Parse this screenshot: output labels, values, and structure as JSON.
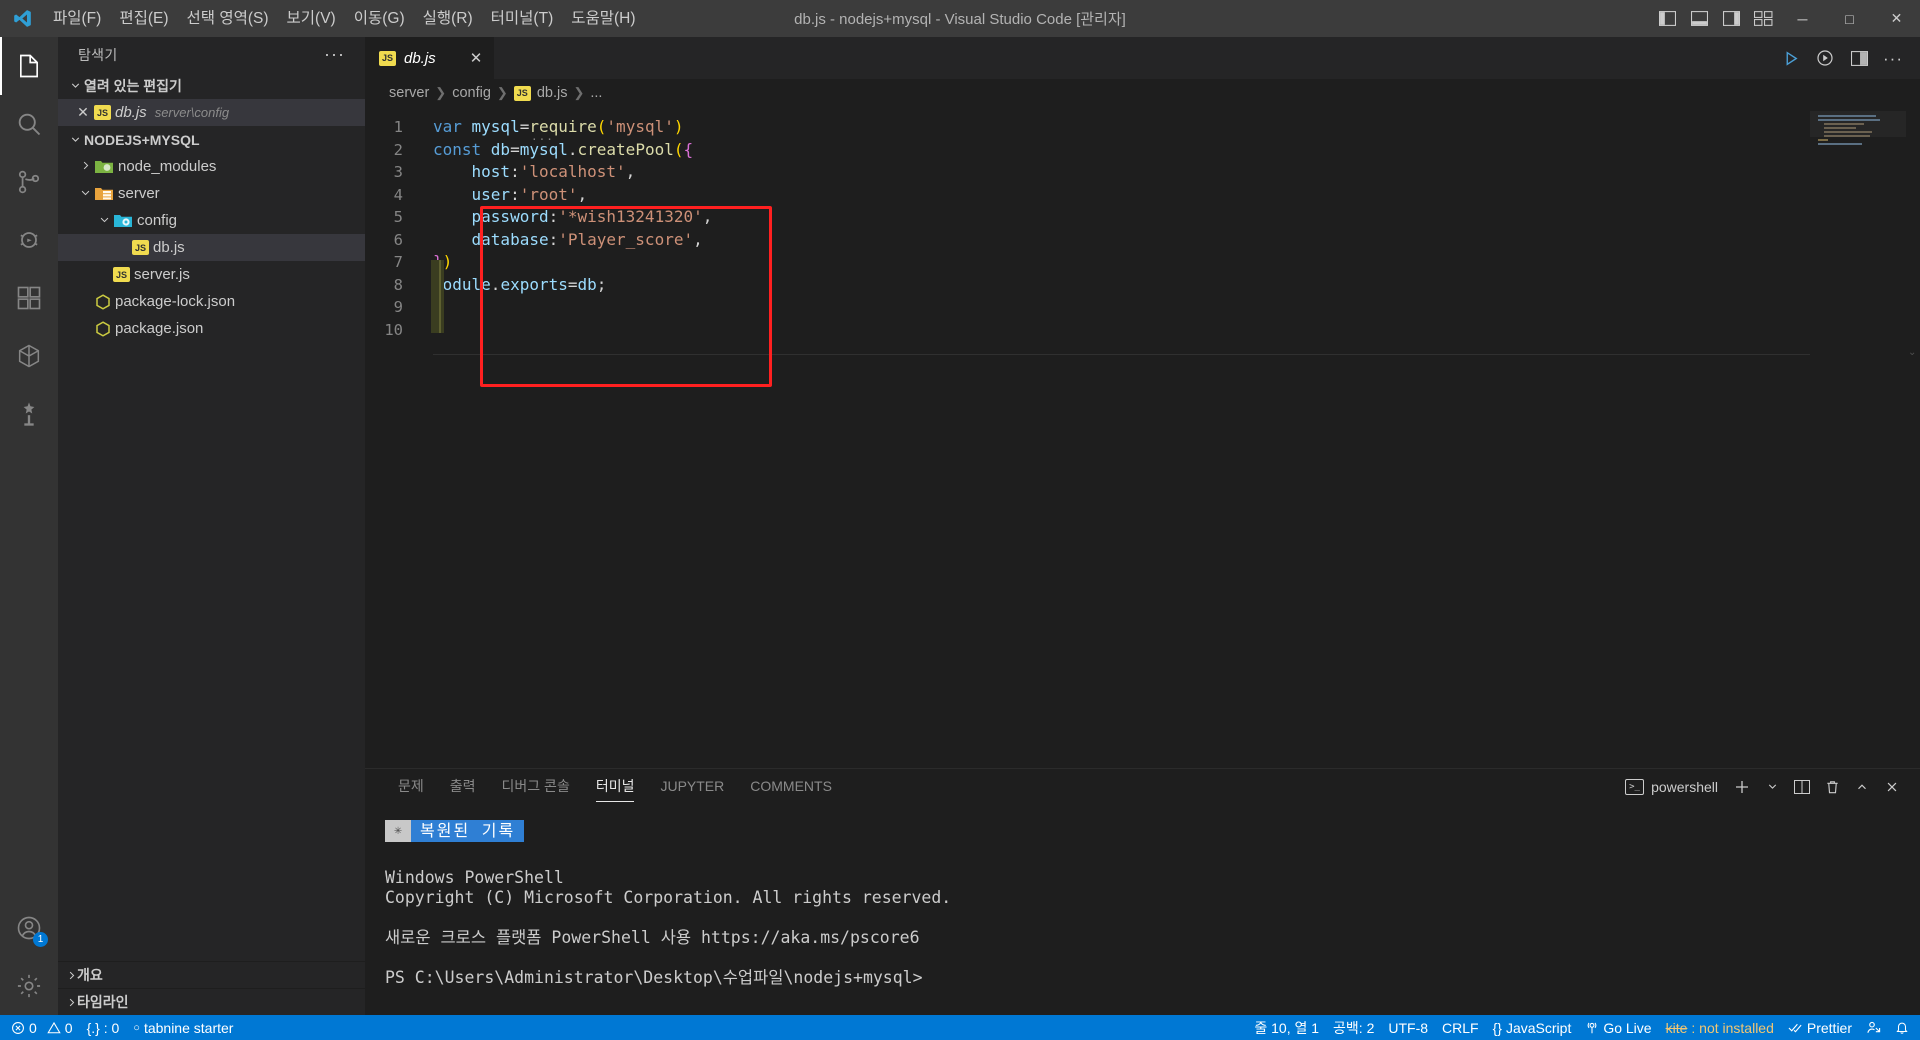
{
  "titlebar": {
    "window_title": "db.js - nodejs+mysql - Visual Studio Code [관리자]",
    "menus": [
      {
        "label": "파일(F)",
        "name": "menu-file"
      },
      {
        "label": "편집(E)",
        "name": "menu-edit"
      },
      {
        "label": "선택 영역(S)",
        "name": "menu-selection"
      },
      {
        "label": "보기(V)",
        "name": "menu-view"
      },
      {
        "label": "이동(G)",
        "name": "menu-go"
      },
      {
        "label": "실행(R)",
        "name": "menu-run"
      },
      {
        "label": "터미널(T)",
        "name": "menu-terminal"
      },
      {
        "label": "도움말(H)",
        "name": "menu-help"
      }
    ],
    "window_controls": {
      "minimize": "─",
      "maximize": "□",
      "close": "✕"
    }
  },
  "activitybar": {
    "items": [
      {
        "name": "explorer",
        "icon": "files-icon",
        "active": true
      },
      {
        "name": "search",
        "icon": "search-icon",
        "active": false
      },
      {
        "name": "source-control",
        "icon": "source-control-icon",
        "active": false
      },
      {
        "name": "run-and-debug",
        "icon": "debug-icon",
        "active": false
      },
      {
        "name": "extensions",
        "icon": "extensions-icon",
        "active": false
      },
      {
        "name": "remote-explorer",
        "icon": "remote-icon",
        "active": false
      },
      {
        "name": "testing",
        "icon": "beaker-icon",
        "active": false
      }
    ],
    "account_badge": "1"
  },
  "sidebar": {
    "title": "탐색기",
    "more_actions": "···",
    "open_editors": {
      "label": "열려 있는 편집기",
      "items": [
        {
          "filename": "db.js",
          "description": "server\\config",
          "icon": "js-file-icon",
          "close": "✕"
        }
      ]
    },
    "workspace": {
      "label": "NODEJS+MYSQL",
      "tree": [
        {
          "label": "node_modules",
          "type": "folder",
          "depth": 1,
          "expanded": false,
          "icon": "folder-node-icon"
        },
        {
          "label": "server",
          "type": "folder",
          "depth": 1,
          "expanded": true,
          "icon": "folder-server-icon"
        },
        {
          "label": "config",
          "type": "folder",
          "depth": 2,
          "expanded": true,
          "icon": "folder-config-icon"
        },
        {
          "label": "db.js",
          "type": "file",
          "depth": 3,
          "icon": "js-file-icon",
          "selected": true
        },
        {
          "label": "server.js",
          "type": "file",
          "depth": 2,
          "icon": "js-file-icon"
        },
        {
          "label": "package-lock.json",
          "type": "file",
          "depth": 1,
          "icon": "json-file-icon"
        },
        {
          "label": "package.json",
          "type": "file",
          "depth": 1,
          "icon": "json-file-icon"
        }
      ]
    },
    "bottom_sections": [
      {
        "label": "개요",
        "name": "outline-section"
      },
      {
        "label": "타임라인",
        "name": "timeline-section"
      }
    ]
  },
  "editor": {
    "tab": {
      "filename": "db.js",
      "icon": "js-file-icon",
      "close": "✕",
      "dirty": false
    },
    "actions": [
      {
        "name": "run-code-button",
        "icon": "play-icon"
      },
      {
        "name": "run-and-debug-button",
        "icon": "play-circle-icon"
      },
      {
        "name": "split-editor-button",
        "icon": "split-icon"
      },
      {
        "name": "more-actions-button",
        "icon": "ellipsis-icon"
      }
    ],
    "breadcrumb": [
      "server",
      "config",
      "db.js",
      "..."
    ],
    "ghost_suggestion": "···",
    "lines": [
      {
        "n": 1,
        "tokens": [
          {
            "t": "var ",
            "c": "t-kw"
          },
          {
            "t": "mysql",
            "c": "t-var"
          },
          {
            "t": "=",
            "c": "t-pn"
          },
          {
            "t": "require",
            "c": "t-fn"
          },
          {
            "t": "(",
            "c": "t-brkt1"
          },
          {
            "t": "'mysql'",
            "c": "t-str"
          },
          {
            "t": ")",
            "c": "t-brkt1"
          }
        ]
      },
      {
        "n": 2,
        "tokens": [
          {
            "t": "const ",
            "c": "t-kw"
          },
          {
            "t": "db",
            "c": "t-var"
          },
          {
            "t": "=",
            "c": "t-pn"
          },
          {
            "t": "mysql",
            "c": "t-var"
          },
          {
            "t": ".",
            "c": "t-pn"
          },
          {
            "t": "createPool",
            "c": "t-fn"
          },
          {
            "t": "(",
            "c": "t-brkt1"
          },
          {
            "t": "{",
            "c": "t-brkt2"
          }
        ]
      },
      {
        "n": 3,
        "tokens": [
          {
            "t": "    host",
            "c": "t-prop"
          },
          {
            "t": ":",
            "c": "t-pn"
          },
          {
            "t": "'localhost'",
            "c": "t-str"
          },
          {
            "t": ",",
            "c": "t-pn"
          }
        ]
      },
      {
        "n": 4,
        "tokens": [
          {
            "t": "    user",
            "c": "t-prop"
          },
          {
            "t": ":",
            "c": "t-pn"
          },
          {
            "t": "'root'",
            "c": "t-str"
          },
          {
            "t": ",",
            "c": "t-pn"
          }
        ]
      },
      {
        "n": 5,
        "tokens": [
          {
            "t": "    password",
            "c": "t-prop"
          },
          {
            "t": ":",
            "c": "t-pn"
          },
          {
            "t": "'*wish13241320'",
            "c": "t-str"
          },
          {
            "t": ",",
            "c": "t-pn"
          }
        ]
      },
      {
        "n": 6,
        "tokens": [
          {
            "t": "    database",
            "c": "t-prop"
          },
          {
            "t": ":",
            "c": "t-pn"
          },
          {
            "t": "'Player_score'",
            "c": "t-str"
          },
          {
            "t": ",",
            "c": "t-pn"
          }
        ]
      },
      {
        "n": 7,
        "tokens": [
          {
            "t": "}",
            "c": "t-brkt2"
          },
          {
            "t": ")",
            "c": "t-brkt1"
          }
        ]
      },
      {
        "n": 8,
        "tokens": [
          {
            "t": "module",
            "c": "t-var"
          },
          {
            "t": ".",
            "c": "t-pn"
          },
          {
            "t": "exports",
            "c": "t-var"
          },
          {
            "t": "=",
            "c": "t-pn"
          },
          {
            "t": "db",
            "c": "t-var"
          },
          {
            "t": ";",
            "c": "t-pn"
          }
        ]
      },
      {
        "n": 9,
        "tokens": []
      },
      {
        "n": 10,
        "tokens": []
      }
    ]
  },
  "panel": {
    "tabs": [
      {
        "label": "문제",
        "name": "tab-problems",
        "active": false
      },
      {
        "label": "출력",
        "name": "tab-output",
        "active": false
      },
      {
        "label": "디버그 콘솔",
        "name": "tab-debug-console",
        "active": false
      },
      {
        "label": "터미널",
        "name": "tab-terminal",
        "active": true
      },
      {
        "label": "JUPYTER",
        "name": "tab-jupyter",
        "active": false
      },
      {
        "label": "COMMENTS",
        "name": "tab-comments",
        "active": false
      }
    ],
    "terminal_name": "powershell",
    "actions": [
      {
        "name": "new-terminal-button",
        "icon": "plus-icon"
      },
      {
        "name": "terminal-profile-dropdown",
        "icon": "chevron-down-icon"
      },
      {
        "name": "split-terminal-button",
        "icon": "split-icon"
      },
      {
        "name": "kill-terminal-button",
        "icon": "trash-icon"
      },
      {
        "name": "maximize-panel-button",
        "icon": "chevron-up-icon"
      },
      {
        "name": "close-panel-button",
        "icon": "close-icon"
      }
    ],
    "terminal": {
      "restore_chip": {
        "star": "✳",
        "label": "복원된 기록"
      },
      "lines": [
        "Windows PowerShell",
        "Copyright (C) Microsoft Corporation. All rights reserved.",
        "",
        "새로운 크로스 플랫폼 PowerShell 사용 https://aka.ms/pscore6",
        "",
        "PS C:\\Users\\Administrator\\Desktop\\수업파일\\nodejs+mysql>"
      ]
    }
  },
  "statusbar": {
    "left": [
      {
        "name": "remote-indicator",
        "icon": "",
        "label": ""
      },
      {
        "name": "problems-status",
        "icon": "error-icon",
        "label": "0"
      },
      {
        "name": "warnings-status",
        "icon": "warning-icon",
        "label": "0"
      },
      {
        "name": "ports-status",
        "icon": "braces-icon",
        "label": "{.} : 0"
      },
      {
        "name": "tabnine-status",
        "icon": "circle-icon",
        "label": "tabnine starter"
      }
    ],
    "right": [
      {
        "name": "cursor-position",
        "label": "줄 10, 열 1"
      },
      {
        "name": "indentation",
        "label": "공백: 2"
      },
      {
        "name": "encoding",
        "label": "UTF-8"
      },
      {
        "name": "eol",
        "label": "CRLF"
      },
      {
        "name": "language-mode",
        "label": "JavaScript",
        "icon": "braces-icon"
      },
      {
        "name": "go-live",
        "label": "Go Live",
        "icon": "broadcast-icon"
      },
      {
        "name": "kite-status",
        "label": "kite: not installed",
        "icon": ""
      },
      {
        "name": "prettier-status",
        "label": "Prettier",
        "icon": "checkmarks-icon"
      },
      {
        "name": "feedback-button",
        "label": "",
        "icon": "person-feedback-icon"
      },
      {
        "name": "notifications-bell",
        "label": "",
        "icon": "bell-icon"
      }
    ]
  },
  "colors": {
    "accent": "#0078d4",
    "titlebar_bg": "#3c3c3c",
    "sidebar_bg": "#252526",
    "editor_bg": "#1e1e1e",
    "activitybar_bg": "#333333",
    "highlight_box": "#ff2020",
    "js_yellow": "#f0db4f",
    "warning_yellow": "#f0c674"
  }
}
